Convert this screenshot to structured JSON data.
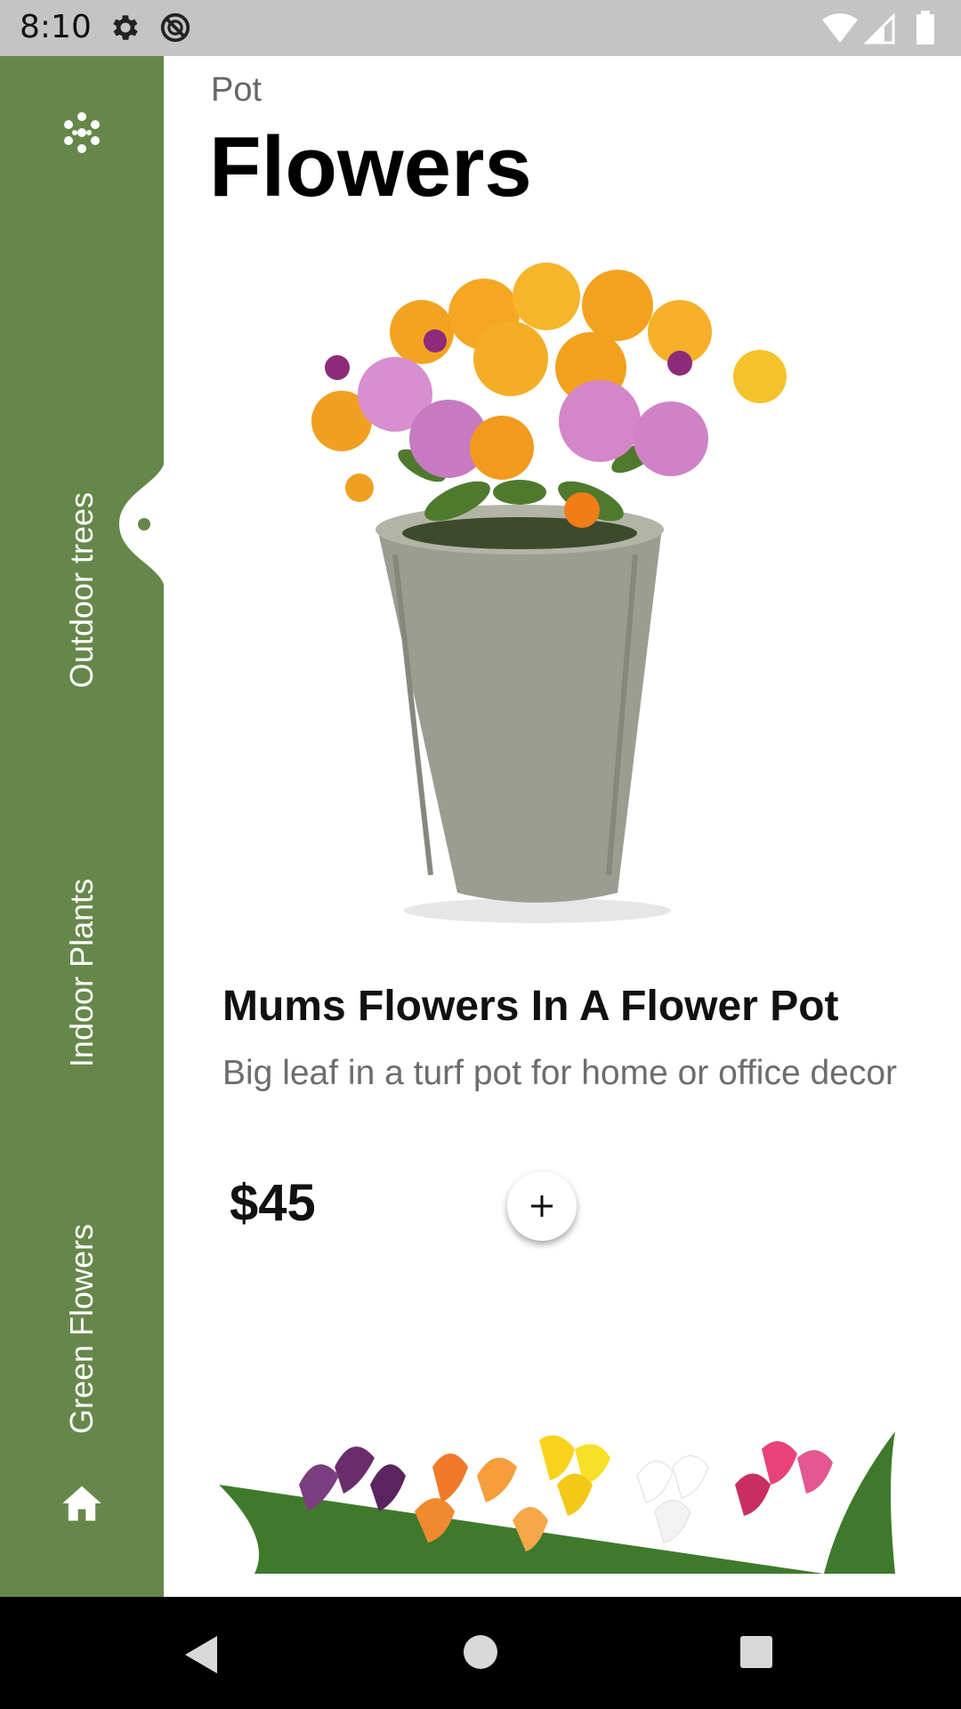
{
  "status_bar": {
    "time": "8:10",
    "icons": [
      "gear-icon",
      "do-not-disturb-icon",
      "wifi-icon",
      "cell-signal-icon",
      "battery-icon"
    ]
  },
  "sidebar": {
    "background": "#66874a",
    "logo_icon": "dots-logo-icon",
    "tabs": [
      {
        "label": "Outdoor trees",
        "selected": true
      },
      {
        "label": "Indoor Plants",
        "selected": false
      },
      {
        "label": "Green Flowers",
        "selected": false
      }
    ],
    "home_icon": "home-icon"
  },
  "header": {
    "subtitle": "Pot",
    "title": "Flowers"
  },
  "product": {
    "image_icon": "flower-pot-image",
    "name": "Mums Flowers In A Flower Pot",
    "description": "Big leaf in a turf pot for home or office decor",
    "price": "$45",
    "add_icon": "plus-icon"
  },
  "next_product": {
    "image_icon": "calla-lilies-image"
  },
  "nav_bar": {
    "icons": [
      "back-icon",
      "home-circle-icon",
      "recents-icon"
    ]
  }
}
